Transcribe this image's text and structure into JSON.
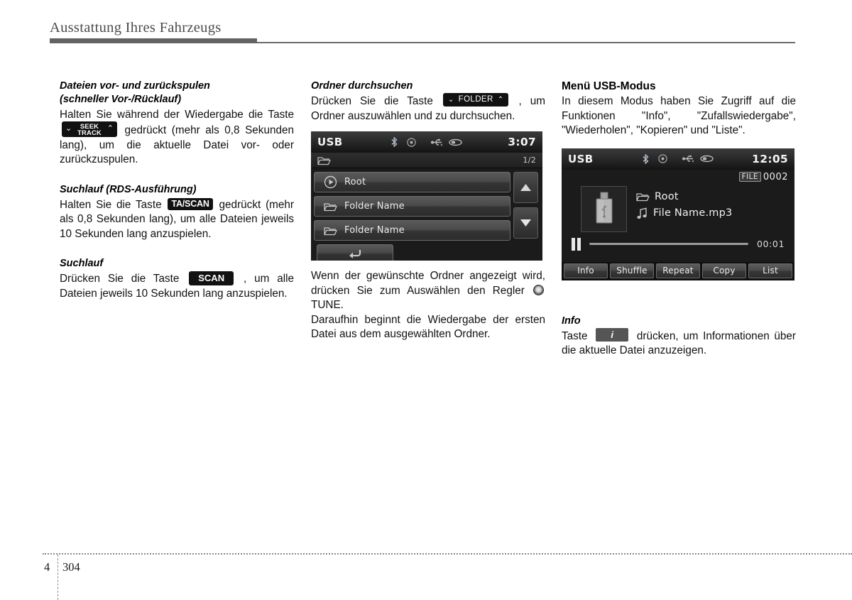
{
  "header": {
    "chapter_title": "Ausstattung Ihres Fahrzeugs"
  },
  "footer": {
    "chapter_number": "4",
    "page_number": "304"
  },
  "column_left": {
    "section1": {
      "heading_line1": "Dateien vor- und zurückspulen",
      "heading_line2": "(schneller Vor-/Rücklauf)",
      "text_before_key": "Halten Sie während der Wiedergabe die Taste",
      "key": {
        "top": "SEEK",
        "bottom": "TRACK",
        "chevron_left": "⌄",
        "chevron_right": "⌃"
      },
      "text_after_key": "gedrückt (mehr als 0,8 Sekunden lang), um die aktuelle Datei vor- oder zurückzuspulen."
    },
    "section2": {
      "heading": "Suchlauf (RDS-Ausführung)",
      "text_before_key": "Halten Sie die Taste",
      "key_label": "TA/SCAN",
      "text_after_key": "gedrückt (mehr als 0,8 Sekunden lang), um alle Dateien jeweils 10 Sekunden lang anzuspielen."
    },
    "section3": {
      "heading": "Suchlauf",
      "text_before_key": "Drücken Sie die Taste",
      "key_label": "SCAN",
      "text_after_key": ", um alle Dateien jeweils 10 Sekunden lang anzuspielen."
    }
  },
  "column_middle": {
    "section": {
      "heading": "Ordner durchsuchen",
      "text_before_key": "Drücken Sie die Taste",
      "key_label": "FOLDER",
      "key_chevron_left": "⌄",
      "key_chevron_right": "⌃",
      "text_after_key": ", um Ordner auszuwählen und zu durchsuchen."
    },
    "screen": {
      "source": "USB",
      "clock": "3:07",
      "status_icons": [
        "bluetooth-icon",
        "disc-icon",
        "usb-icon",
        "usb-plug-icon"
      ],
      "path_icon": "folder-icon",
      "page_indicator": "1/2",
      "rows": [
        {
          "icon": "play-circle-icon",
          "label": "Root"
        },
        {
          "icon": "folder-icon",
          "label": "Folder Name"
        },
        {
          "icon": "folder-icon",
          "label": "Folder Name"
        }
      ],
      "scroll_up": "▲",
      "scroll_down": "▼",
      "back_button_icon": "back-arrow-icon"
    },
    "caption1": "Wenn der gewünschte Ordner angezeigt wird, drücken Sie zum Auswählen den Regler",
    "caption1_knob": "TUNE.",
    "caption2": "Daraufhin beginnt die Wiedergabe der ersten Datei aus dem ausgewählten Ordner."
  },
  "column_right": {
    "section": {
      "heading": "Menü USB-Modus",
      "text": "In diesem Modus haben Sie Zugriff auf die Funktionen \"Info\", \"Zufallswiedergabe\", \"Wiederholen\", \"Kopieren\" und \"Liste\"."
    },
    "screen": {
      "source": "USB",
      "clock": "12:05",
      "status_icons": [
        "bluetooth-icon",
        "disc-icon",
        "usb-icon",
        "usb-plug-icon"
      ],
      "file_badge_label": "FILE",
      "file_badge_number": "0002",
      "album_icon": "usb-stick-icon",
      "folder_name": "Root",
      "file_name": "File Name.mp3",
      "playback_state_icon": "pause-icon",
      "elapsed_time": "00:01",
      "softkeys": [
        "Info",
        "Shuffle",
        "Repeat",
        "Copy",
        "List"
      ]
    },
    "info_section": {
      "heading": "Info",
      "text_before_key": "Taste",
      "key_label": "i",
      "text_after_key": "drücken, um Informationen über die aktuelle Datei anzuzeigen."
    }
  },
  "colors": {
    "header_rule": "#636363",
    "screen_bg": "#1b1b1b",
    "key_bg": "#111111",
    "info_key_bg": "#555555"
  }
}
